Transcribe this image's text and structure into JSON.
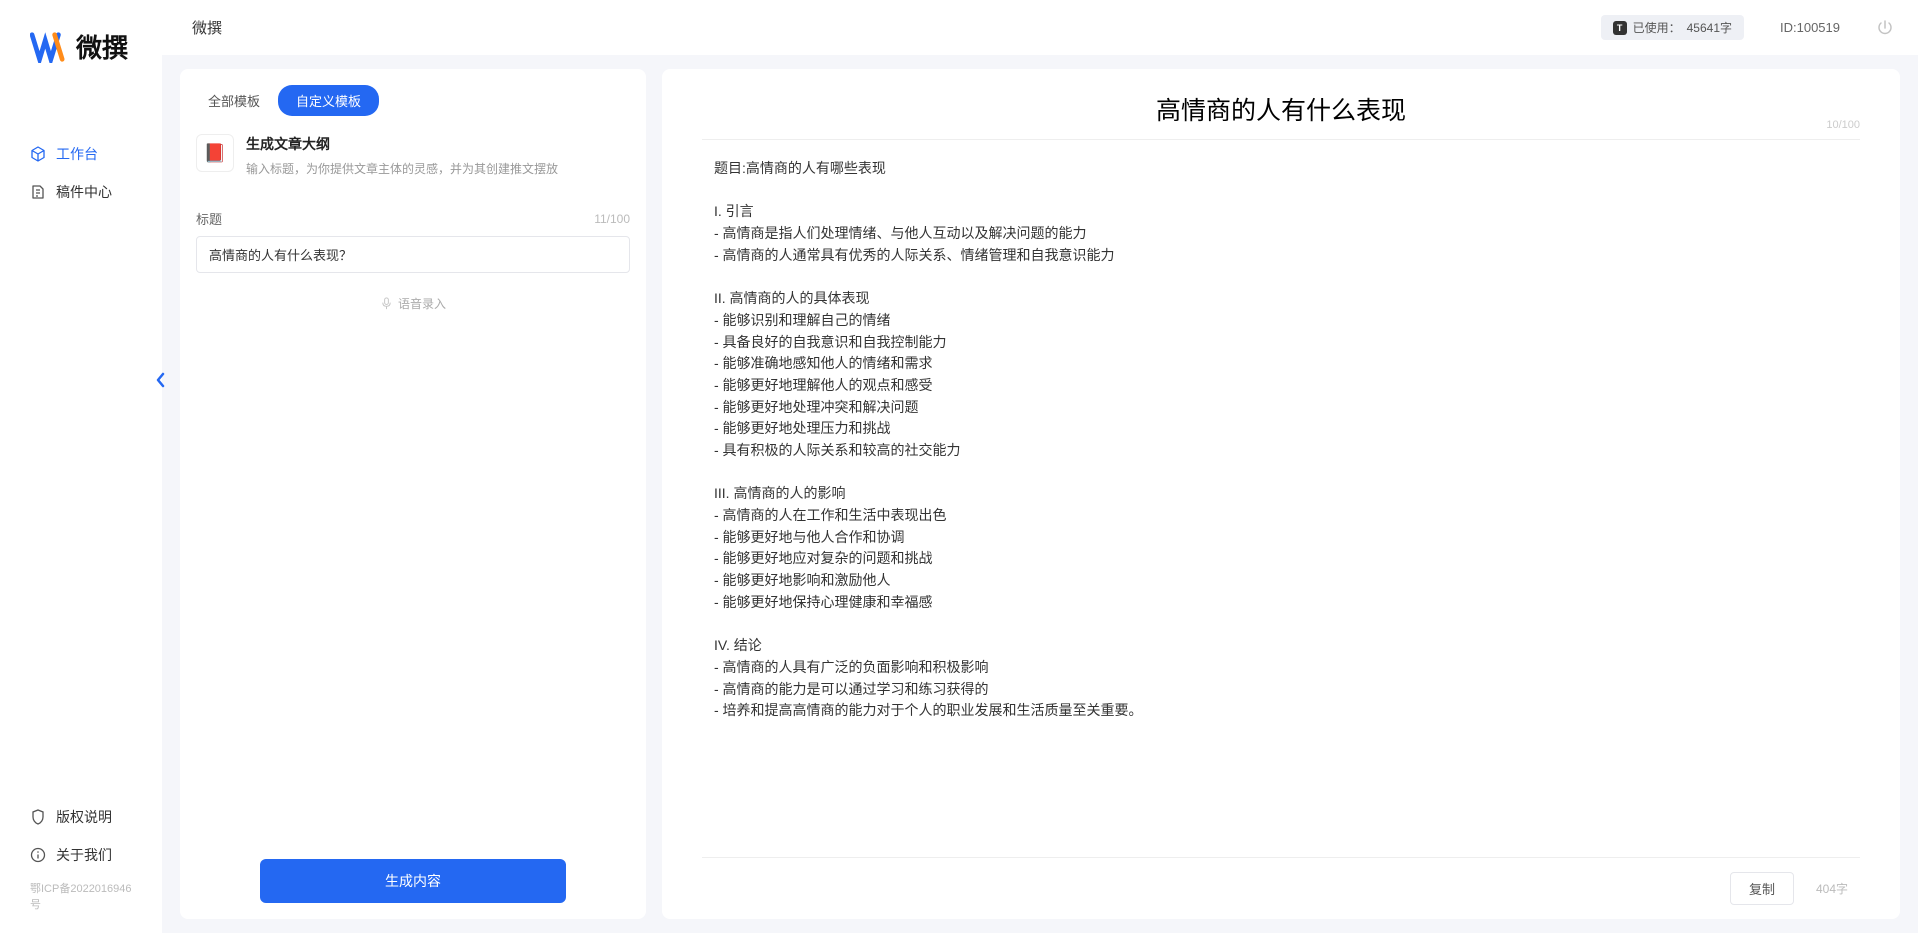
{
  "brand": "微撰",
  "sidebar": {
    "nav": [
      {
        "label": "工作台",
        "active": true
      },
      {
        "label": "稿件中心",
        "active": false
      }
    ],
    "bottom": [
      {
        "label": "版权说明"
      },
      {
        "label": "关于我们"
      }
    ],
    "icp": "鄂ICP备2022016946号"
  },
  "header": {
    "title": "微撰",
    "usage_label": "已使用：",
    "usage_value": "45641字",
    "id_label": "ID:100519"
  },
  "left_panel": {
    "tabs": [
      {
        "label": "全部模板",
        "active": false
      },
      {
        "label": "自定义模板",
        "active": true
      }
    ],
    "template": {
      "icon": "📕",
      "title": "生成文章大纲",
      "desc": "输入标题，为你提供文章主体的灵感，并为其创建推文摆放"
    },
    "form": {
      "label": "标题",
      "counter": "11/100",
      "value": "高情商的人有什么表现？",
      "voice_hint": "语音录入"
    },
    "generate_btn": "生成内容"
  },
  "output": {
    "title": "高情商的人有什么表现",
    "title_counter": "10/100",
    "body": "题目:高情商的人有哪些表现\n\nI. 引言\n- 高情商是指人们处理情绪、与他人互动以及解决问题的能力\n- 高情商的人通常具有优秀的人际关系、情绪管理和自我意识能力\n\nII. 高情商的人的具体表现\n- 能够识别和理解自己的情绪\n- 具备良好的自我意识和自我控制能力\n- 能够准确地感知他人的情绪和需求\n- 能够更好地理解他人的观点和感受\n- 能够更好地处理冲突和解决问题\n- 能够更好地处理压力和挑战\n- 具有积极的人际关系和较高的社交能力\n\nIII. 高情商的人的影响\n- 高情商的人在工作和生活中表现出色\n- 能够更好地与他人合作和协调\n- 能够更好地应对复杂的问题和挑战\n- 能够更好地影响和激励他人\n- 能够更好地保持心理健康和幸福感\n\nIV. 结论\n- 高情商的人具有广泛的负面影响和积极影响\n- 高情商的能力是可以通过学习和练习获得的\n- 培养和提高高情商的能力对于个人的职业发展和生活质量至关重要。",
    "copy_btn": "复制",
    "word_count": "404字"
  }
}
